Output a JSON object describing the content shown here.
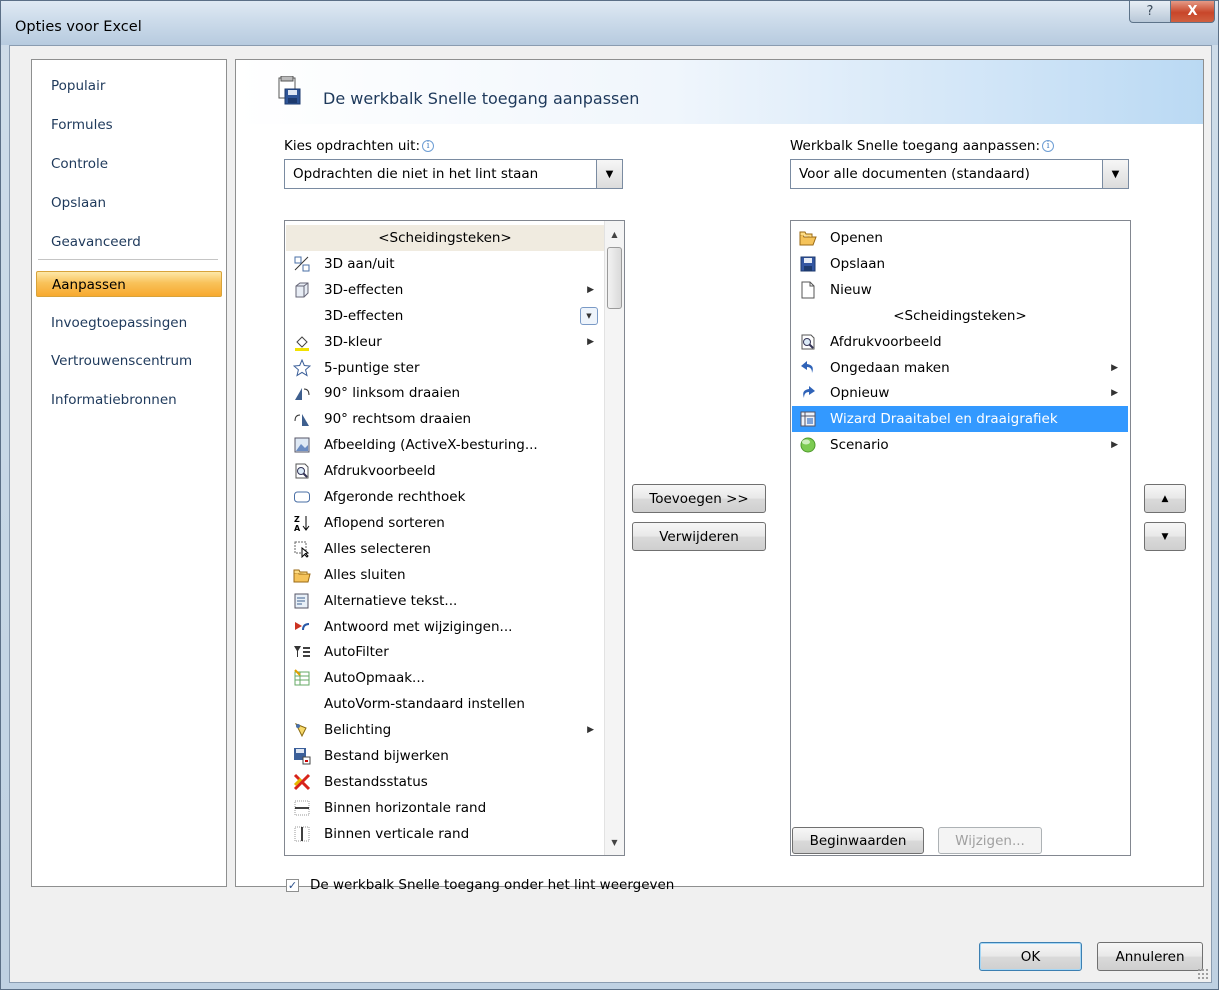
{
  "window": {
    "title": "Opties voor Excel",
    "help_glyph": "?",
    "close_glyph": "X"
  },
  "nav": {
    "items": [
      {
        "label": "Populair"
      },
      {
        "label": "Formules"
      },
      {
        "label": "Controle"
      },
      {
        "label": "Opslaan"
      },
      {
        "label": "Geavanceerd"
      },
      {
        "label": "Aanpassen",
        "active": true
      },
      {
        "label": "Invoegtoepassingen"
      },
      {
        "label": "Vertrouwenscentrum"
      },
      {
        "label": "Informatiebronnen"
      }
    ]
  },
  "header": {
    "title": "De werkbalk Snelle toegang aanpassen",
    "icon": "quick-access-toolbar-icon"
  },
  "left": {
    "label": "Kies opdrachten uit:",
    "combo_value": "Opdrachten die niet in het lint staan",
    "items": [
      {
        "label": "<Scheidingsteken>",
        "separator": true,
        "icon": ""
      },
      {
        "label": "3D aan/uit",
        "icon": "3d-toggle-icon"
      },
      {
        "label": "3D-effecten",
        "icon": "3d-cube-icon",
        "submenu": true
      },
      {
        "label": "3D-effecten",
        "icon": "",
        "dropdown": true
      },
      {
        "label": "3D-kleur",
        "icon": "paint-bucket-icon",
        "submenu": true
      },
      {
        "label": "5-puntige ster",
        "icon": "star-icon"
      },
      {
        "label": "90° linksom draaien",
        "icon": "rotate-left-icon"
      },
      {
        "label": "90° rechtsom draaien",
        "icon": "rotate-right-icon"
      },
      {
        "label": "Afbeelding (ActiveX-besturing...",
        "icon": "picture-icon"
      },
      {
        "label": "Afdrukvoorbeeld",
        "icon": "print-preview-icon"
      },
      {
        "label": "Afgeronde rechthoek",
        "icon": "rounded-rect-icon"
      },
      {
        "label": "Aflopend sorteren",
        "icon": "sort-desc-icon"
      },
      {
        "label": "Alles selecteren",
        "icon": "select-all-icon"
      },
      {
        "label": "Alles sluiten",
        "icon": "close-all-icon"
      },
      {
        "label": "Alternatieve tekst...",
        "icon": "alt-text-icon"
      },
      {
        "label": "Antwoord met wijzigingen...",
        "icon": "reply-changes-icon"
      },
      {
        "label": "AutoFilter",
        "icon": "autofilter-icon"
      },
      {
        "label": "AutoOpmaak...",
        "icon": "autoformat-icon"
      },
      {
        "label": "AutoVorm-standaard instellen",
        "icon": ""
      },
      {
        "label": "Belichting",
        "icon": "lighting-icon",
        "submenu": true
      },
      {
        "label": "Bestand bijwerken",
        "icon": "update-file-icon"
      },
      {
        "label": "Bestandsstatus",
        "icon": "file-status-icon"
      },
      {
        "label": "Binnen horizontale rand",
        "icon": "inside-horizontal-border-icon"
      },
      {
        "label": "Binnen verticale rand",
        "icon": "inside-vertical-border-icon"
      }
    ]
  },
  "right": {
    "label": "Werkbalk Snelle toegang aanpassen:",
    "combo_value": "Voor alle documenten (standaard)",
    "items": [
      {
        "label": "Openen",
        "icon": "open-folder-icon"
      },
      {
        "label": "Opslaan",
        "icon": "save-disk-icon"
      },
      {
        "label": "Nieuw",
        "icon": "new-document-icon"
      },
      {
        "label": "<Scheidingsteken>",
        "separator": true,
        "icon": ""
      },
      {
        "label": "Afdrukvoorbeeld",
        "icon": "print-preview-icon"
      },
      {
        "label": "Ongedaan maken",
        "icon": "undo-icon",
        "submenu": true
      },
      {
        "label": "Opnieuw",
        "icon": "redo-icon",
        "submenu": true
      },
      {
        "label": "Wizard Draaitabel en draaigrafiek",
        "icon": "pivot-wizard-icon",
        "selected": true
      },
      {
        "label": "Scenario",
        "icon": "scenario-icon",
        "submenu": true
      }
    ]
  },
  "buttons": {
    "add": "Toevoegen >>",
    "remove": "Verwijderen",
    "reset": "Beginwaarden",
    "modify": "Wijzigen...",
    "ok": "OK",
    "cancel": "Annuleren",
    "move_up": "▲",
    "move_down": "▼"
  },
  "checkbox": {
    "label": "De werkbalk Snelle toegang onder het lint weergeven",
    "checked": true
  }
}
